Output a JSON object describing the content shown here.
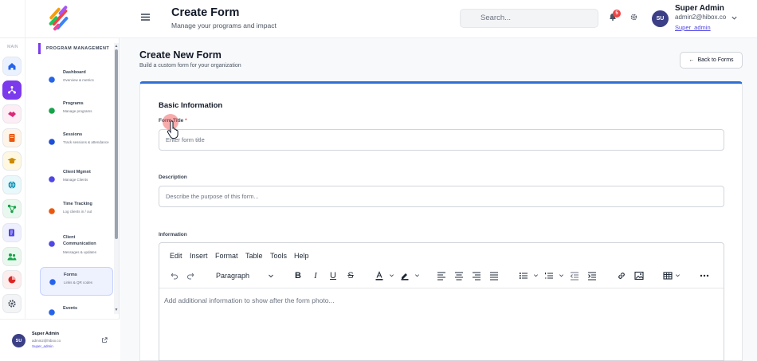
{
  "header": {
    "title": "Create Form",
    "subtitle": "Manage your programs and impact",
    "search_placeholder": "Search...",
    "notification_count": "5",
    "user": {
      "initials": "SU",
      "name": "Super Admin",
      "email": "admin2@hibox.co",
      "role": "Super_admin"
    }
  },
  "rail": {
    "main_label": "MAIN",
    "items": [
      {
        "name": "home",
        "color": "#2563eb",
        "bg": "#eaf2ff"
      },
      {
        "name": "network",
        "color": "#ffffff",
        "bg": "#7c3aed"
      },
      {
        "name": "handshake",
        "color": "#db2777",
        "bg": "#fdeef5"
      },
      {
        "name": "book",
        "color": "#ea580c",
        "bg": "#fff4e8"
      },
      {
        "name": "graduation",
        "color": "#ca8a04",
        "bg": "#fff8e1"
      },
      {
        "name": "globe",
        "color": "#0891b2",
        "bg": "#e8f8fb"
      },
      {
        "name": "flow",
        "color": "#16a34a",
        "bg": "#e9f8ee"
      },
      {
        "name": "report",
        "color": "#4f46e5",
        "bg": "#eef0ff"
      },
      {
        "name": "people",
        "color": "#16a34a",
        "bg": "#e9f8ee"
      },
      {
        "name": "pie",
        "color": "#dc2626",
        "bg": "#fdeeee"
      },
      {
        "name": "settings",
        "color": "#4b5563",
        "bg": "#f3f4f6"
      }
    ]
  },
  "sidebar": {
    "section_title": "PROGRAM MANAGEMENT",
    "items": [
      {
        "title": "Dashboard",
        "sub": "Overview & metrics",
        "icon_color": "#2563eb"
      },
      {
        "title": "Programs",
        "sub": "Manage programs",
        "icon_color": "#16a34a"
      },
      {
        "title": "Sessions",
        "sub": "Track sessions & attendance",
        "icon_color": "#1d4ed8"
      },
      {
        "title": "Client Mgmnt",
        "sub": "Manage Clients",
        "icon_color": "#4f46e5"
      },
      {
        "title": "Time Tracking",
        "sub": "Log clients in / out",
        "icon_color": "#ea580c"
      },
      {
        "title": "Client Communication",
        "sub": "Messages & updates",
        "icon_color": "#4f46e5"
      },
      {
        "title": "Forms",
        "sub": "Links & QR codes",
        "icon_color": "#2563eb"
      },
      {
        "title": "Events",
        "sub": "",
        "icon_color": "#2563eb"
      }
    ],
    "footer_user": {
      "initials": "SU",
      "name": "Super Admin",
      "email": "admin2@hibox.co",
      "role": "Super_admin"
    }
  },
  "page": {
    "title": "Create New Form",
    "subtitle": "Build a custom form for your organization",
    "back_label": "Back to Forms"
  },
  "form": {
    "section_title": "Basic Information",
    "title_label": "Form Title",
    "required_mark": "*",
    "title_placeholder": "Enter form title",
    "description_label": "Description",
    "description_placeholder": "Describe the purpose of this form...",
    "information_label": "Information",
    "editor": {
      "menu": [
        "Edit",
        "Insert",
        "Format",
        "Table",
        "Tools",
        "Help"
      ],
      "block_format": "Paragraph",
      "placeholder": "Add additional information to show after the form photo..."
    }
  },
  "colors": {
    "accent": "#2f6fd6",
    "brand_purple": "#7c3aed",
    "danger": "#ef4444"
  }
}
